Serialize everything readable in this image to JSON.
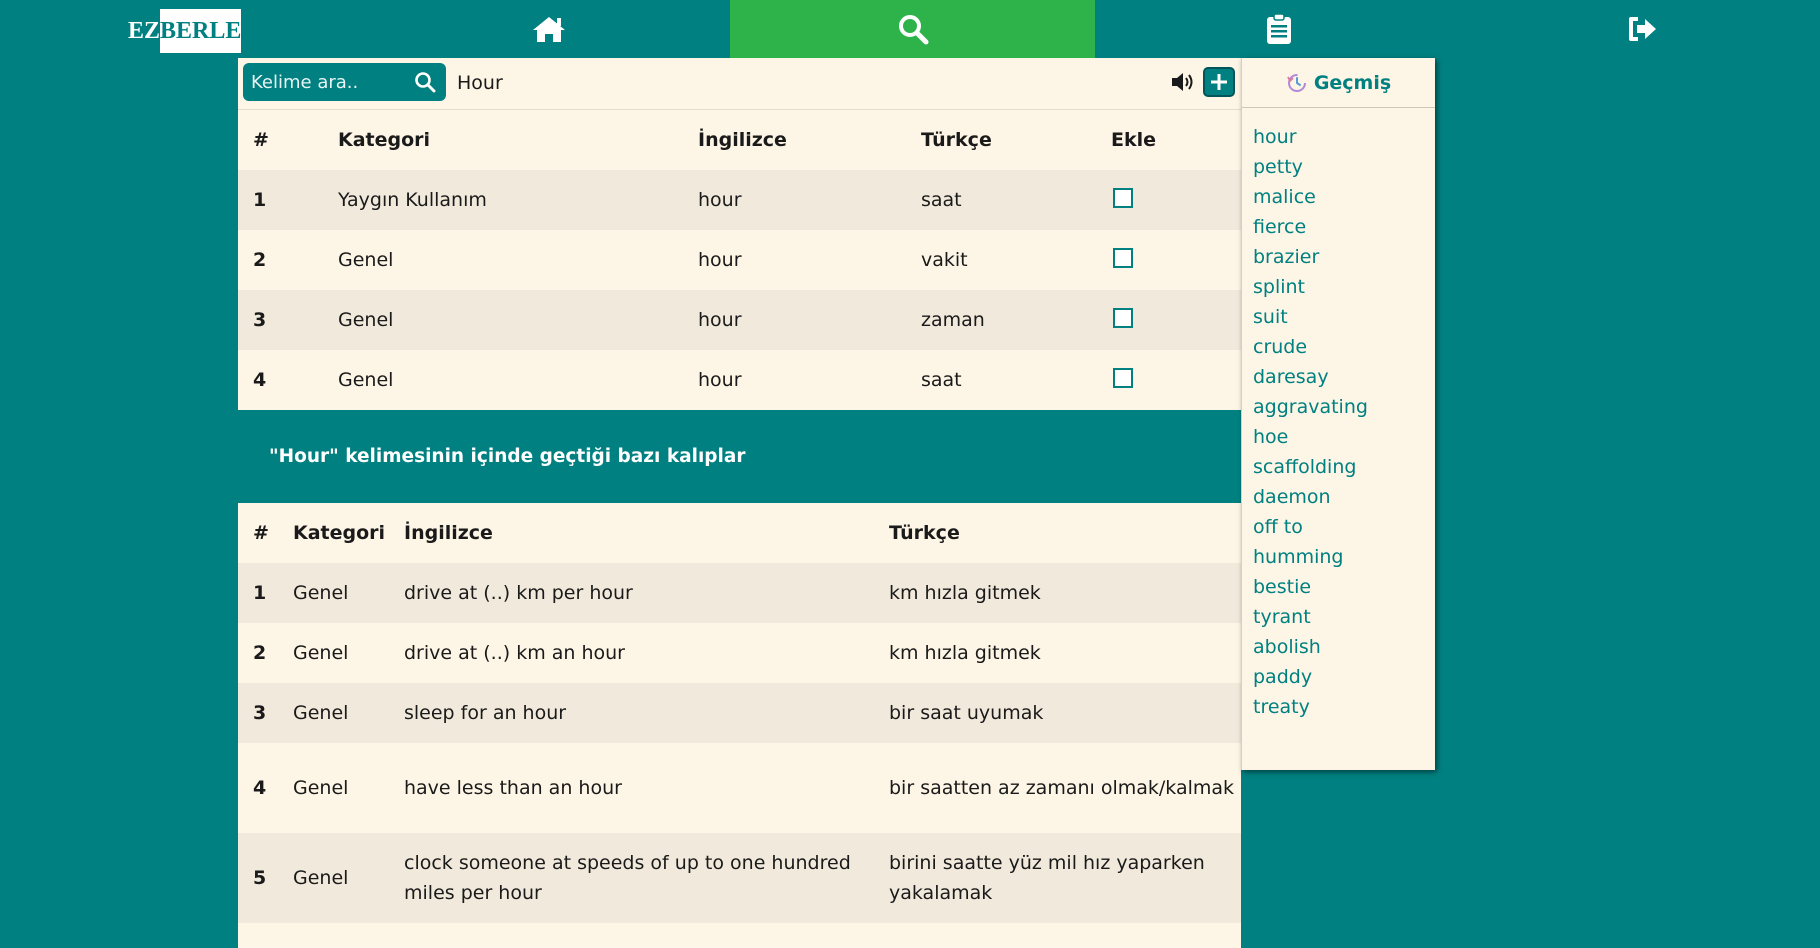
{
  "nav": {
    "logo_left": "EZ",
    "logo_box": "BERLE",
    "items": [
      {
        "icon": "home-icon"
      },
      {
        "icon": "search-icon",
        "active": true
      },
      {
        "icon": "clipboard-icon"
      },
      {
        "icon": "sign-out-icon"
      }
    ]
  },
  "colors": {
    "teal": "#008080",
    "active_green": "#2db34a",
    "panel_bg": "#fdf5e6",
    "row_shade": "#f1e9dc"
  },
  "search": {
    "placeholder": "Kelime ara..",
    "current_word": "Hour"
  },
  "results": {
    "columns": [
      "#",
      "Kategori",
      "İngilizce",
      "Türkçe",
      "Ekle"
    ],
    "rows": [
      {
        "num": "1",
        "category": "Yaygın Kullanım",
        "en": "hour",
        "tr": "saat"
      },
      {
        "num": "2",
        "category": "Genel",
        "en": "hour",
        "tr": "vakit"
      },
      {
        "num": "3",
        "category": "Genel",
        "en": "hour",
        "tr": "zaman"
      },
      {
        "num": "4",
        "category": "Genel",
        "en": "hour",
        "tr": "saat"
      }
    ]
  },
  "patterns": {
    "header": "\"Hour\" kelimesinin içinde geçtiği bazı kalıplar",
    "columns": [
      "#",
      "Kategori",
      "İngilizce",
      "Türkçe"
    ],
    "rows": [
      {
        "num": "1",
        "category": "Genel",
        "en": "drive at (..) km per hour",
        "tr": "km hızla gitmek"
      },
      {
        "num": "2",
        "category": "Genel",
        "en": "drive at (..) km an hour",
        "tr": "km hızla gitmek"
      },
      {
        "num": "3",
        "category": "Genel",
        "en": "sleep for an hour",
        "tr": "bir saat uyumak"
      },
      {
        "num": "4",
        "category": "Genel",
        "en": "have less than an hour",
        "tr": "bir saatten az zamanı olmak/kalmak"
      },
      {
        "num": "5",
        "category": "Genel",
        "en": "clock someone at speeds of up to one hundred miles per hour",
        "tr": "birini saatte yüz mil hız yaparken yakalamak"
      }
    ]
  },
  "history": {
    "title": "Geçmiş",
    "items": [
      "hour",
      "petty",
      "malice",
      "fierce",
      "brazier",
      "splint",
      "suit",
      "crude",
      "daresay",
      "aggravating",
      "hoe",
      "scaffolding",
      "daemon",
      "off to",
      "humming",
      "bestie",
      "tyrant",
      "abolish",
      "paddy",
      "treaty"
    ]
  }
}
